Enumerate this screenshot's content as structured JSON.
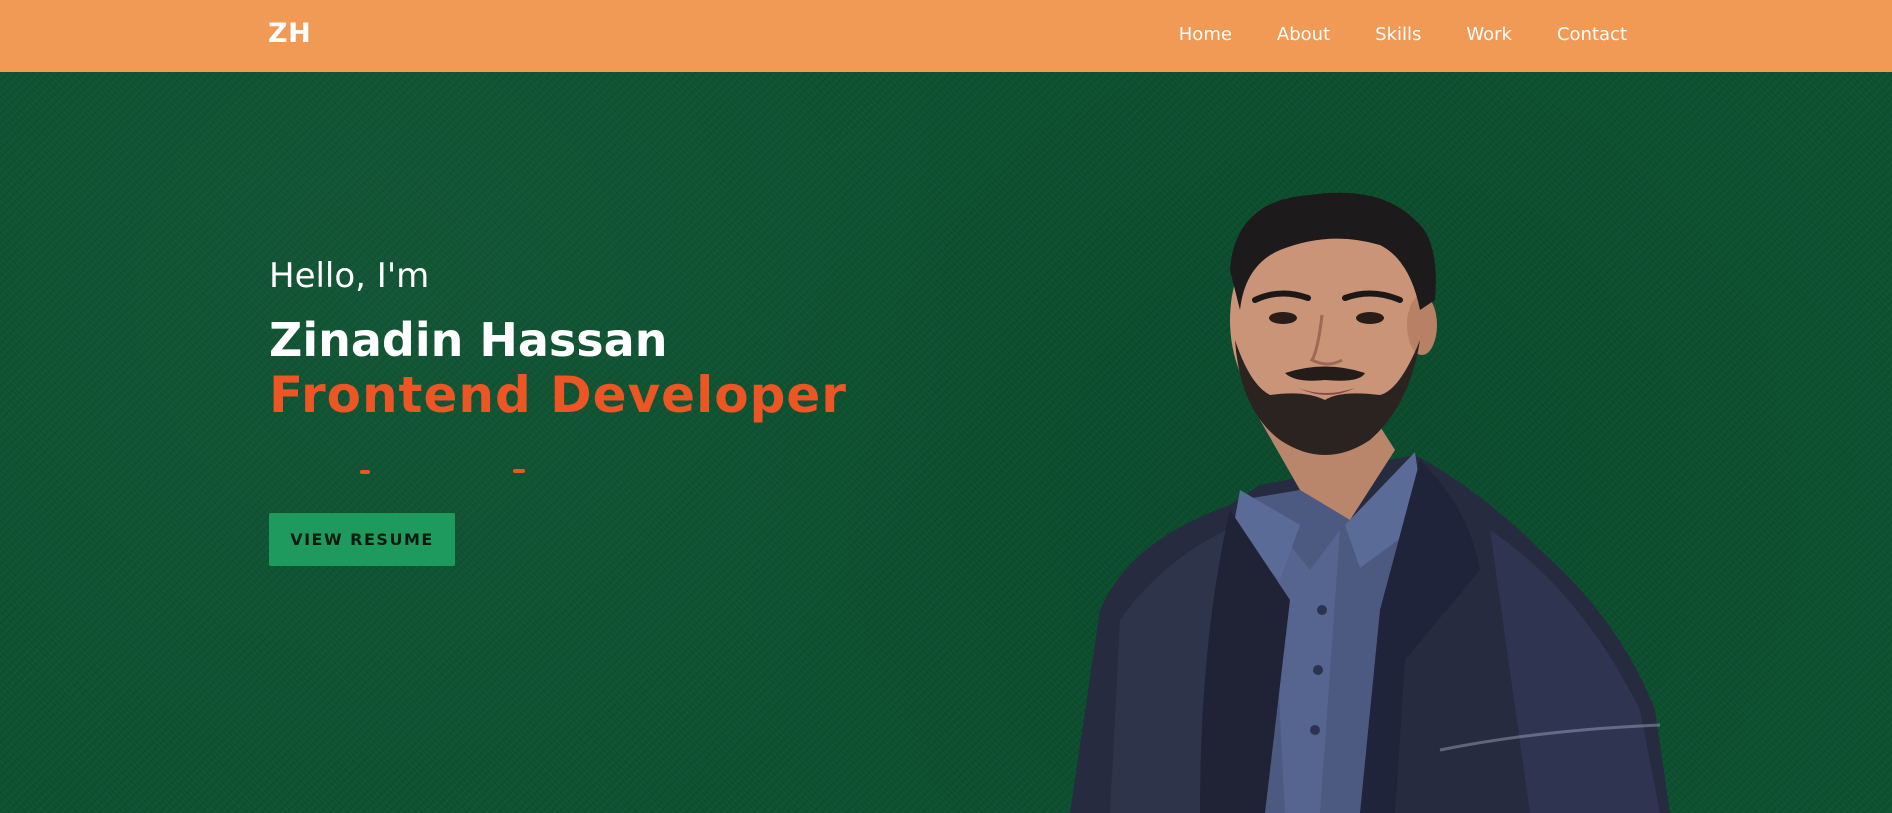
{
  "navbar": {
    "logo": "ZH",
    "links": [
      "Home",
      "About",
      "Skills",
      "Work",
      "Contact"
    ]
  },
  "hero": {
    "greeting": "Hello, I'm",
    "name": "Zinadin Hassan",
    "role": "Frontend Developer",
    "resume_button": "VIEW RESUME"
  },
  "colors": {
    "navbar_bg": "#f09a56",
    "hero_bg": "#0b5130",
    "accent": "#ec5524",
    "button_bg": "#1f9a5f"
  },
  "icons": {
    "portrait": "person-portrait-image"
  }
}
